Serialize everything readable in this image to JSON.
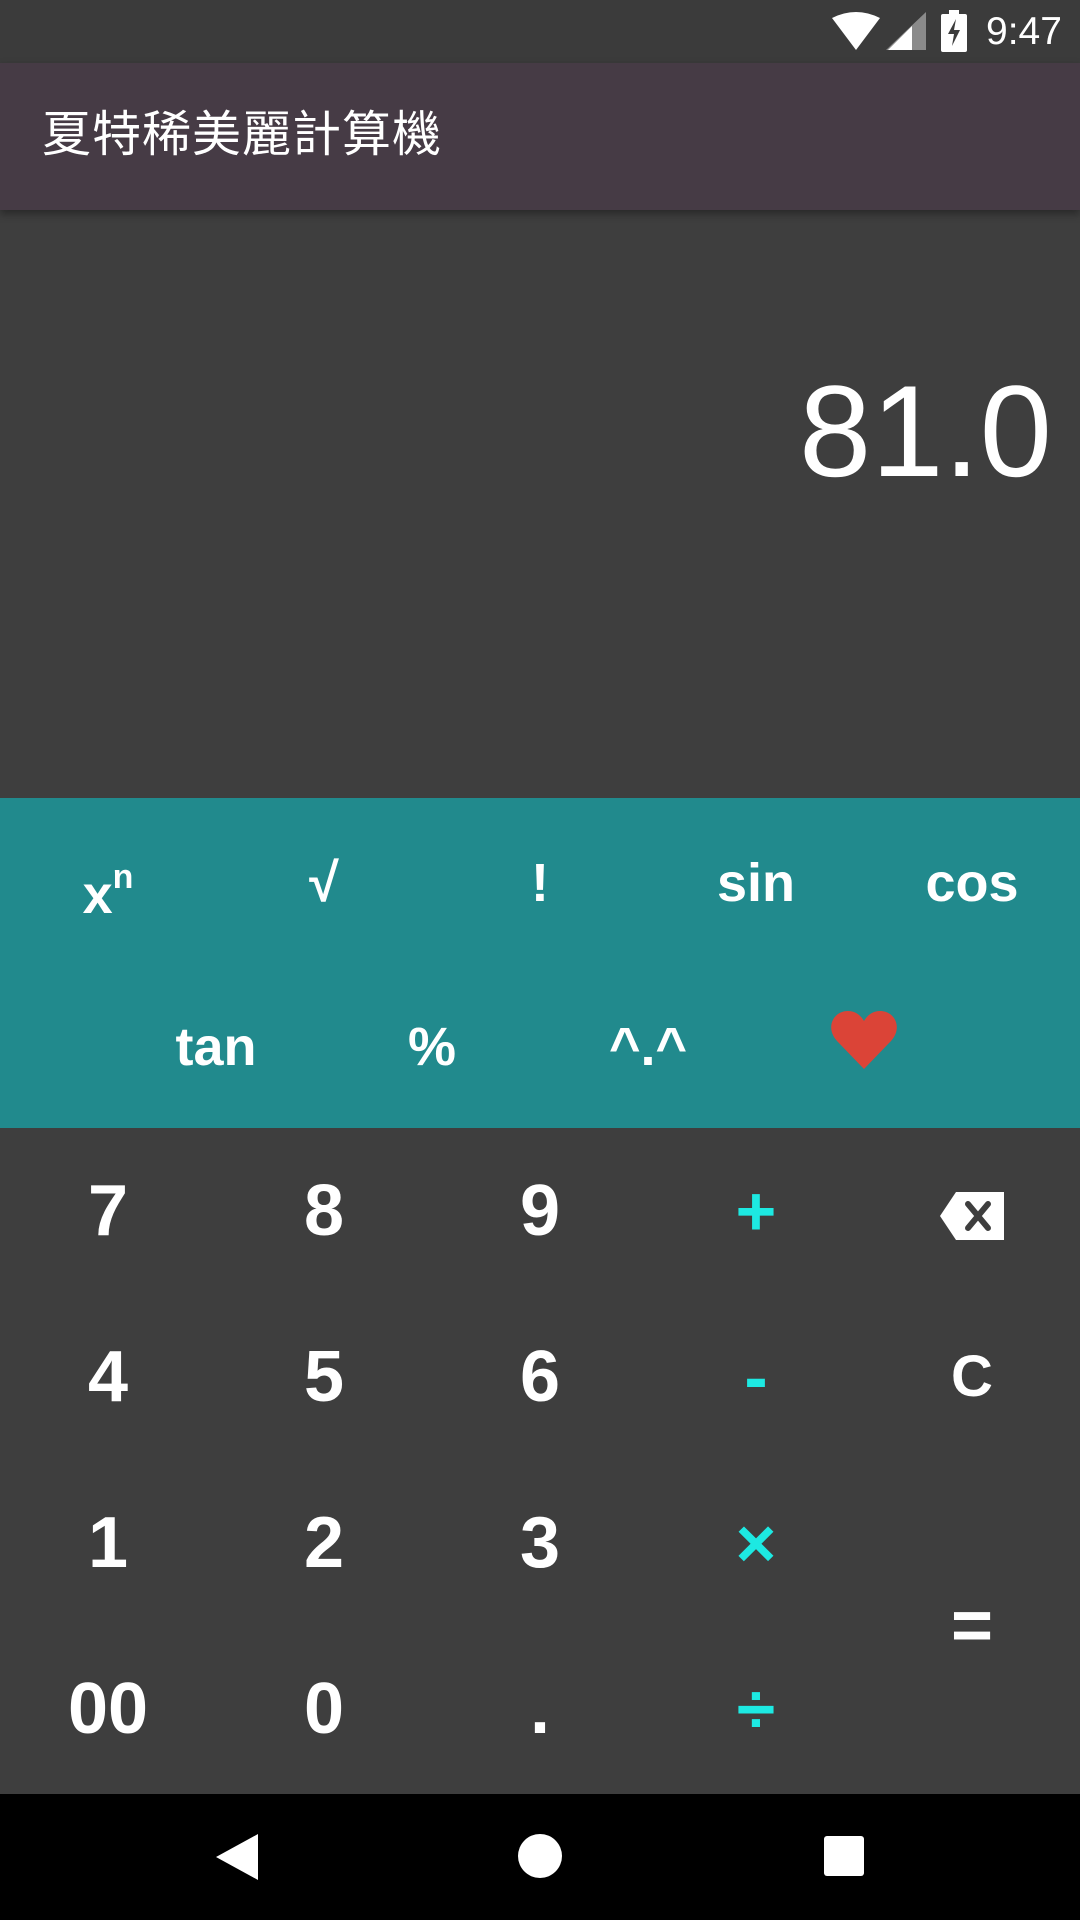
{
  "status_bar": {
    "time": "9:47",
    "icons": [
      "wifi-icon",
      "cell-signal-icon",
      "battery-charging-icon"
    ]
  },
  "app_bar": {
    "title": "夏特稀美麗計算機"
  },
  "display": {
    "value": "81.0"
  },
  "scientific_keys": {
    "row1": [
      {
        "label": "x",
        "sup": "n",
        "name": "power"
      },
      {
        "label": "√",
        "name": "sqrt"
      },
      {
        "label": "!",
        "name": "factorial"
      },
      {
        "label": "sin",
        "name": "sin"
      },
      {
        "label": "cos",
        "name": "cos"
      }
    ],
    "row2": [
      {
        "label": "tan",
        "name": "tan"
      },
      {
        "label": "%",
        "name": "percent"
      },
      {
        "label": "^.^",
        "name": "emoticon"
      },
      {
        "icon": "heart-icon",
        "color": "#db4437",
        "name": "heart"
      }
    ]
  },
  "keypad": {
    "row1": [
      "7",
      "8",
      "9",
      "+"
    ],
    "row2": [
      "4",
      "5",
      "6",
      "-",
      "C"
    ],
    "row3": [
      "1",
      "2",
      "3",
      "×"
    ],
    "row4": [
      "00",
      "0",
      ".",
      "÷"
    ],
    "equals": "=",
    "backspace_icon": "backspace-icon"
  },
  "colors": {
    "operator_accent": "#1de9e2",
    "scientific_panel": "#218a8d",
    "app_bar": "#463b45",
    "background": "#3e3e3e"
  },
  "nav_bar": {
    "icons": [
      "back-icon",
      "home-icon",
      "recent-apps-icon"
    ]
  }
}
